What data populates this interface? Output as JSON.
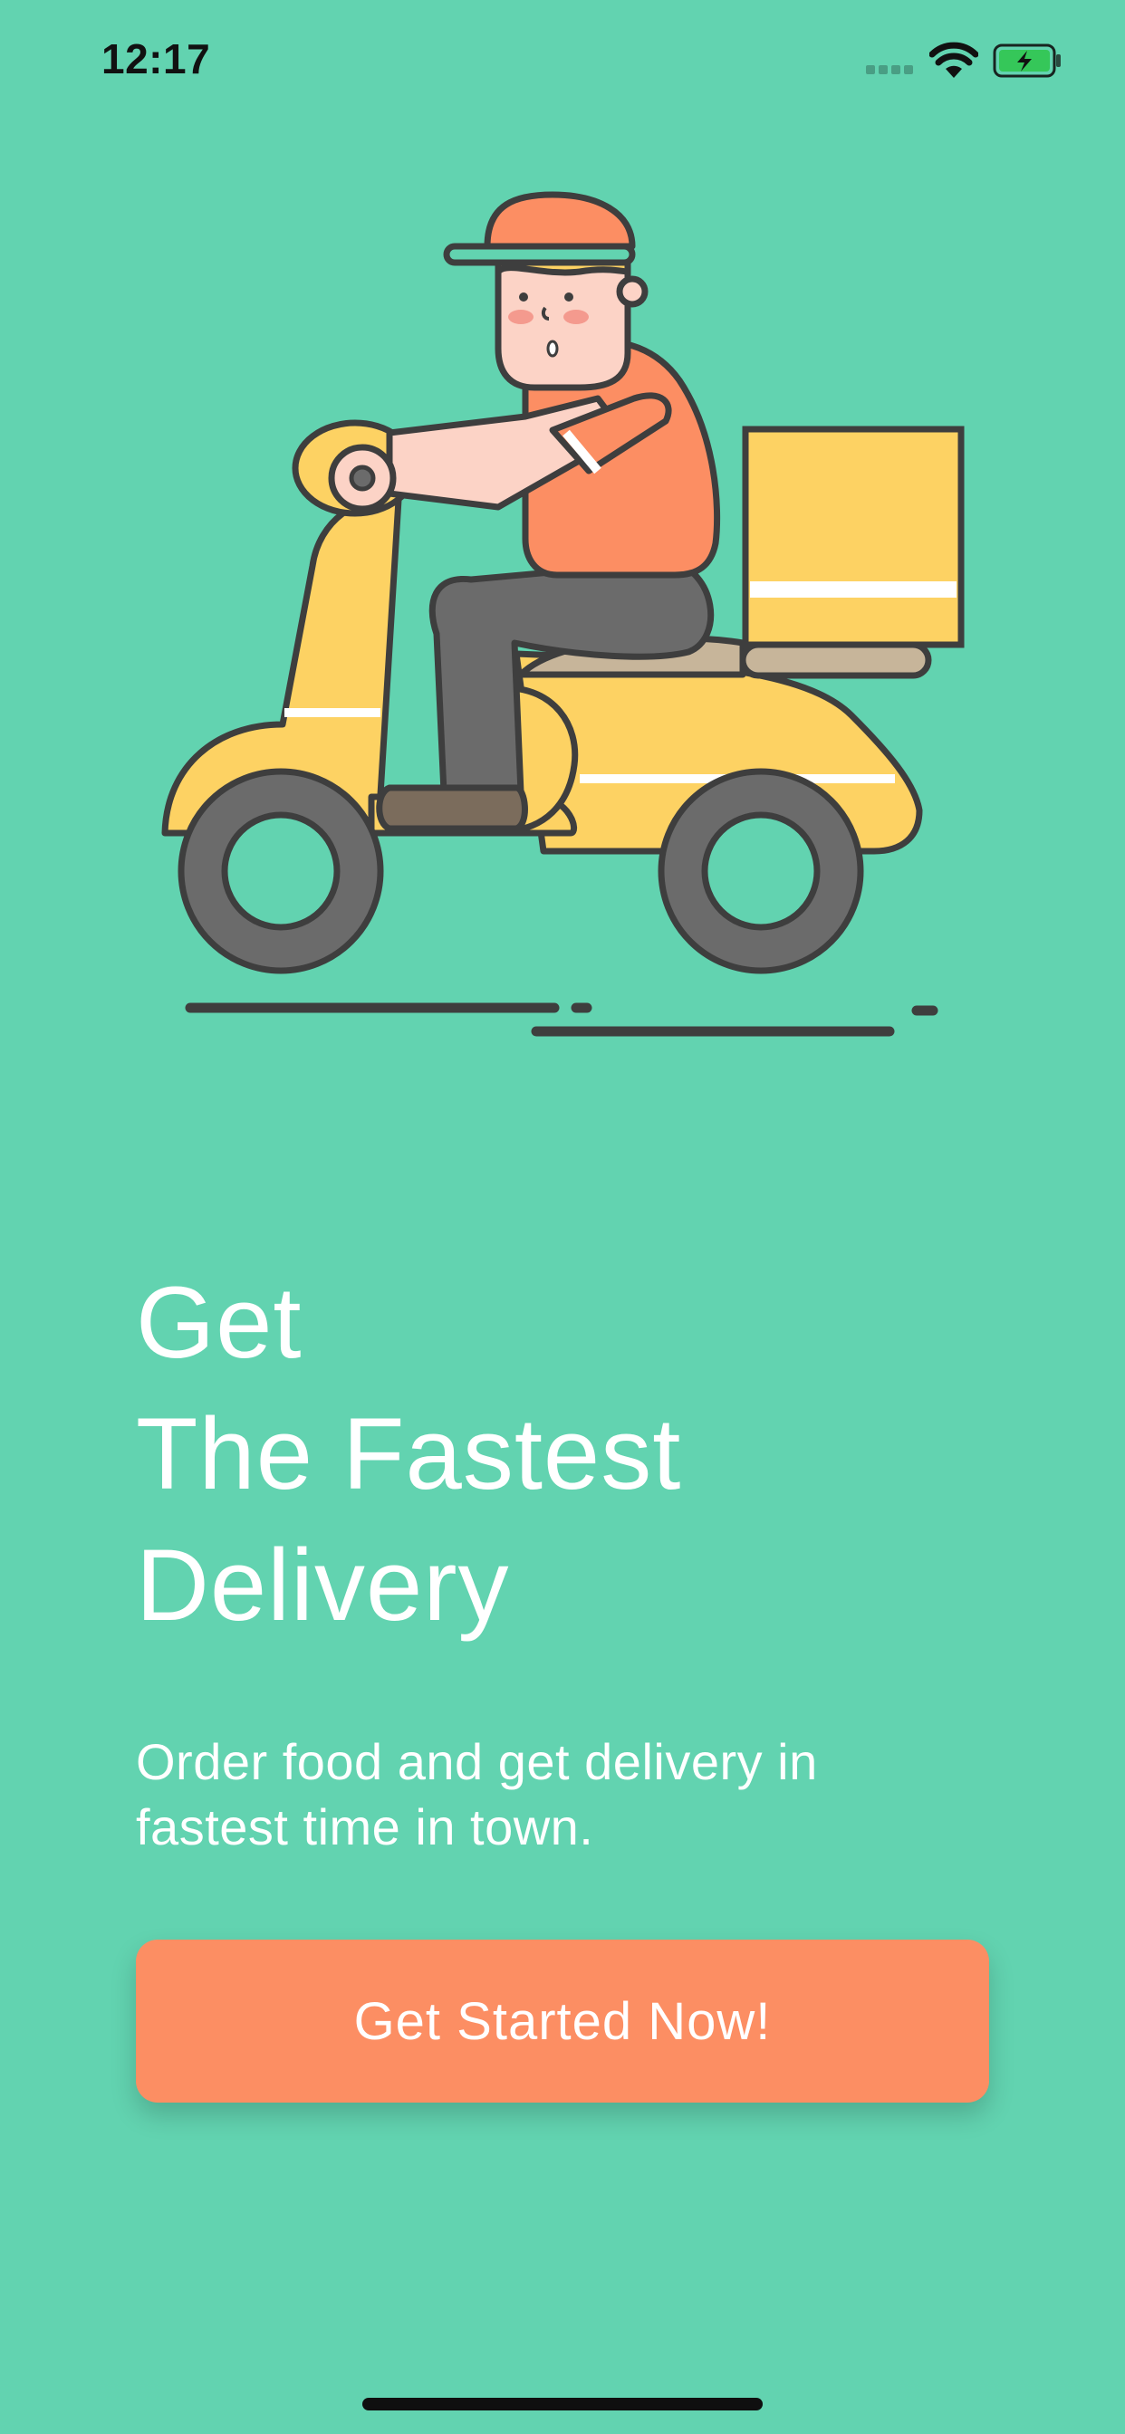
{
  "status_bar": {
    "time": "12:17"
  },
  "headline": {
    "lines": [
      "Get",
      "The Fastest",
      "Delivery"
    ]
  },
  "subtitle": {
    "lines": [
      "Order food and get delivery in",
      "fastest time in town."
    ]
  },
  "cta": {
    "label": "Get Started Now!"
  },
  "colors": {
    "background": "#62D3B0",
    "accent": "#FC8E63",
    "scooter": "#FDD263",
    "tire": "#6B6B6B",
    "outline": "#3E3E3E"
  },
  "icons": {
    "signal": "cellular-signal-icon",
    "wifi": "wifi-icon",
    "battery": "battery-charging-icon",
    "illustration": "delivery-scooter-illustration"
  }
}
